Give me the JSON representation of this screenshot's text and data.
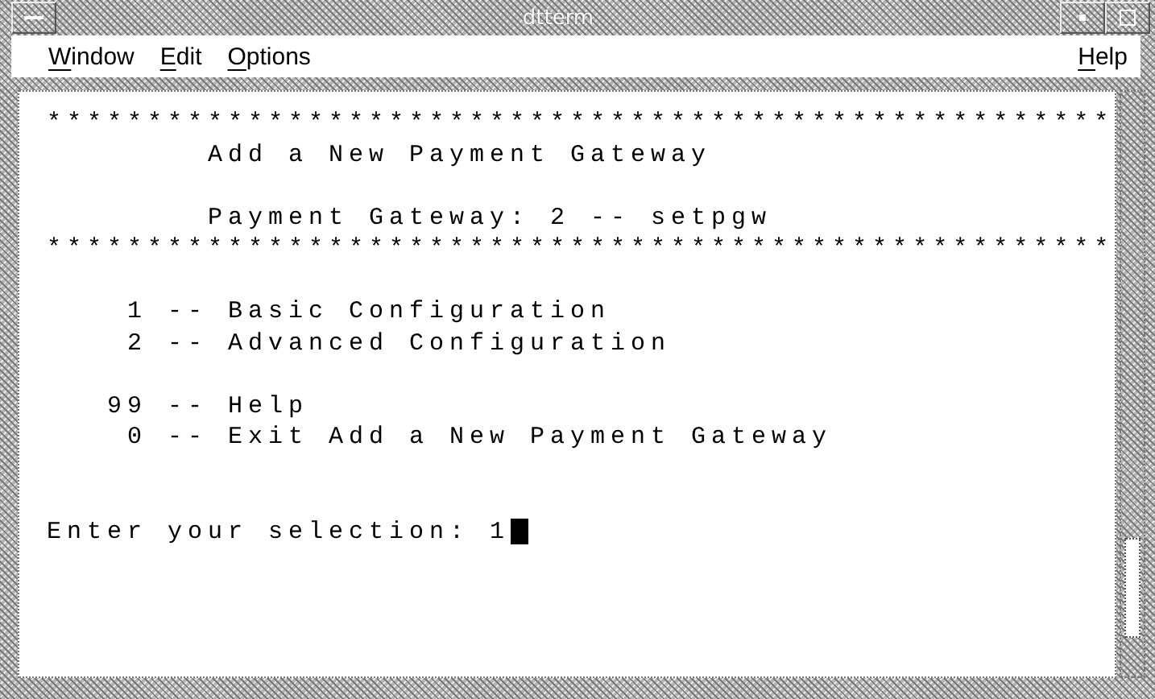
{
  "window": {
    "title": "dtterm"
  },
  "menu_bar": {
    "left": [
      "Window",
      "Edit",
      "Options"
    ],
    "right": [
      "Help"
    ]
  },
  "terminal": {
    "blocks": [
      {
        "lines": [
          "*****************************************************",
          "        Add a New Payment Gateway"
        ]
      },
      {
        "lines": [
          "        Payment Gateway: 2 -- setpgw",
          "*****************************************************"
        ]
      },
      {
        "lines": [
          "    1 -- Basic Configuration",
          "    2 -- Advanced Configuration"
        ]
      },
      {
        "lines": [
          "   99 -- Help",
          "    0 -- Exit Add a New Payment Gateway"
        ]
      }
    ],
    "prompt": "Enter your selection: 1"
  }
}
